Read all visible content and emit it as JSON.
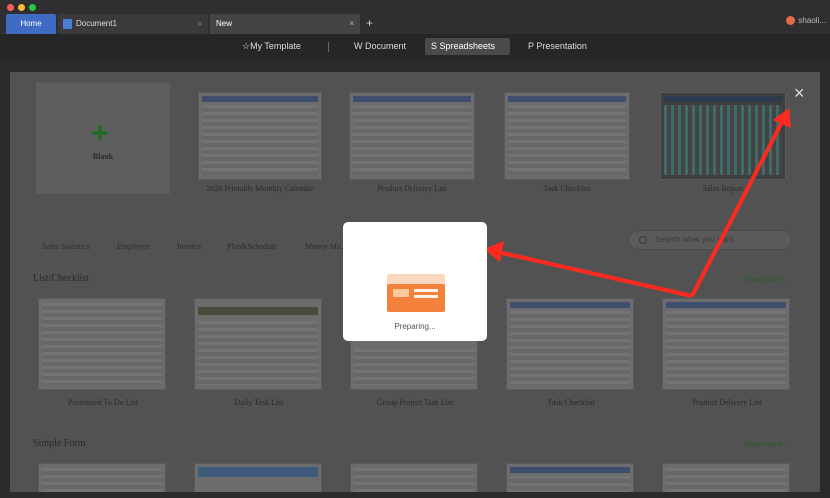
{
  "window": {
    "tabs": [
      {
        "label": "Home"
      },
      {
        "label": "Document1"
      },
      {
        "label": "New"
      }
    ],
    "new_tab_symbol": "+",
    "close_symbol": "×",
    "user_name": "shaoli..."
  },
  "category_bar": {
    "items": [
      {
        "label": "My Template",
        "icon": "star-icon"
      },
      {
        "label": "Document",
        "icon": "document-icon"
      },
      {
        "label": "Spreadsheets",
        "icon": "spreadsheet-icon",
        "active": true
      },
      {
        "label": "Presentation",
        "icon": "presentation-icon"
      }
    ]
  },
  "templates_top": {
    "blank_label": "Blank",
    "items": [
      {
        "caption": "2020 Printable Monthly Calendar"
      },
      {
        "caption": "Product Delivery List"
      },
      {
        "caption": "Task Checklist"
      },
      {
        "caption": "Sales Report"
      }
    ]
  },
  "filters": [
    "Sales Statistics",
    "Employee",
    "Invoice",
    "Plan&Schedule",
    "Money Ma..."
  ],
  "search": {
    "placeholder": "Search what you want"
  },
  "sections": {
    "list_checklist": {
      "title": "List/Checklist",
      "view_more": "View more →",
      "items": [
        {
          "caption": "Prioritized To Do List"
        },
        {
          "caption": "Daily Task List"
        },
        {
          "caption": "Group Project Task List"
        },
        {
          "caption": "Task Checklist"
        },
        {
          "caption": "Product Delivery List"
        }
      ]
    },
    "simple_form": {
      "title": "Simple Form",
      "view_more": "View more →"
    }
  },
  "modal": {
    "status": "Preparing..."
  },
  "colors": {
    "home_tab": "#3f6bc3",
    "modal_accent": "#f4813b",
    "arrow": "#ff2a1f"
  }
}
